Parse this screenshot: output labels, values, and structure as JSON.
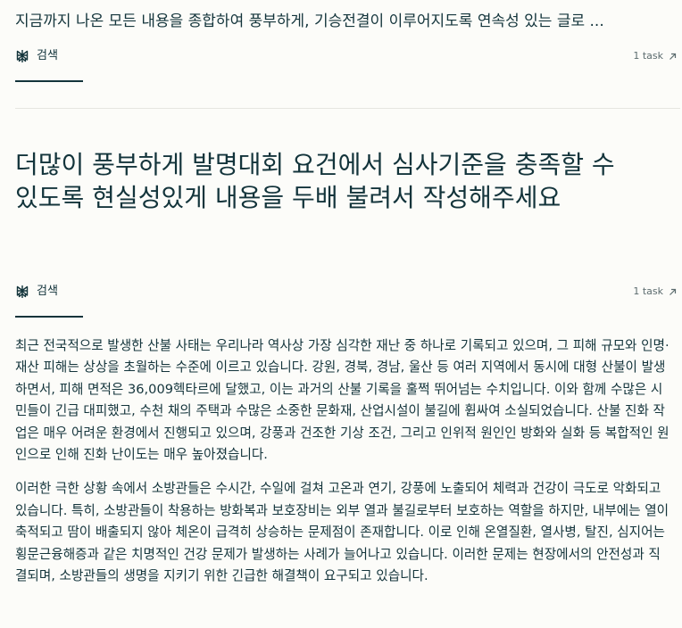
{
  "previous_query": "지금까지 나온 모든 내용을 종합하여 풍부하게, 기승전결이 이루어지도록 연속성 있는 글로 ...",
  "tabs": {
    "search_label": "검색",
    "tasks_label": "1 task"
  },
  "query": "더많이 풍부하게 발명대회 요건에서 심사기준을 충족할 수 있도록 현실성있게 내용을 두배 불려서 작성해주세요",
  "answer": {
    "paragraphs": [
      "최근 전국적으로 발생한 산불 사태는 우리나라 역사상 가장 심각한 재난 중 하나로 기록되고 있으며, 그 피해 규모와 인명·재산 피해는 상상을 초월하는 수준에 이르고 있습니다. 강원, 경북, 경남, 울산 등 여러 지역에서 동시에 대형 산불이 발생하면서, 피해 면적은 36,009헥타르에 달했고, 이는 과거의 산불 기록을 훌쩍 뛰어넘는 수치입니다. 이와 함께 수많은 시민들이 긴급 대피했고, 수천 채의 주택과 수많은 소중한 문화재, 산업시설이 불길에 휩싸여 소실되었습니다. 산불 진화 작업은 매우 어려운 환경에서 진행되고 있으며, 강풍과 건조한 기상 조건, 그리고 인위적 원인인 방화와 실화 등 복합적인 원인으로 인해 진화 난이도는 매우 높아졌습니다.",
      "이러한 극한 상황 속에서 소방관들은 수시간, 수일에 걸쳐 고온과 연기, 강풍에 노출되어 체력과 건강이 극도로 악화되고 있습니다. 특히, 소방관들이 착용하는 방화복과 보호장비는 외부 열과 불길로부터 보호하는 역할을 하지만, 내부에는 열이 축적되고 땀이 배출되지 않아 체온이 급격히 상승하는 문제점이 존재합니다. 이로 인해 온열질환, 열사병, 탈진, 심지어는 횡문근융해증과 같은 치명적인 건강 문제가 발생하는 사례가 늘어나고 있습니다. 이러한 문제는 현장에서의 안전성과 직결되며, 소방관들의 생명을 지키기 위한 긴급한 해결책이 요구되고 있습니다."
    ]
  },
  "icons": {
    "search_tab": "perplexity-logo-icon",
    "tasks_link": "arrow-up-right-icon"
  }
}
